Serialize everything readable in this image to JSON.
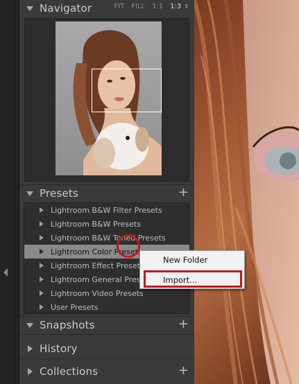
{
  "navigator": {
    "title": "Navigator",
    "zoom_options": [
      "FIT",
      "FILL",
      "1:1",
      "1:3"
    ],
    "zoom_active": "1:3",
    "zoom_stepper": "↕"
  },
  "presets": {
    "title": "Presets",
    "add_symbol": "+",
    "items": [
      {
        "label": "Lightroom B&W Filter Presets"
      },
      {
        "label": "Lightroom B&W Presets"
      },
      {
        "label": "Lightroom B&W Toned Presets"
      },
      {
        "label": "Lightroom Color Presets"
      },
      {
        "label": "Lightroom Effect Presets"
      },
      {
        "label": "Lightroom General Presets"
      },
      {
        "label": "Lightroom Video Presets"
      },
      {
        "label": "User Presets"
      }
    ],
    "selected_index": 3
  },
  "context_menu": {
    "items": [
      {
        "label": "New Folder"
      },
      {
        "label": "Import..."
      }
    ]
  },
  "snapshots": {
    "title": "Snapshots",
    "add_symbol": "+"
  },
  "history": {
    "title": "History"
  },
  "collections": {
    "title": "Collections",
    "add_symbol": "+"
  },
  "colors": {
    "panel_bg": "#3a3a3a",
    "highlight_red": "#c4181f",
    "selected_row": "#8a8a8a"
  }
}
